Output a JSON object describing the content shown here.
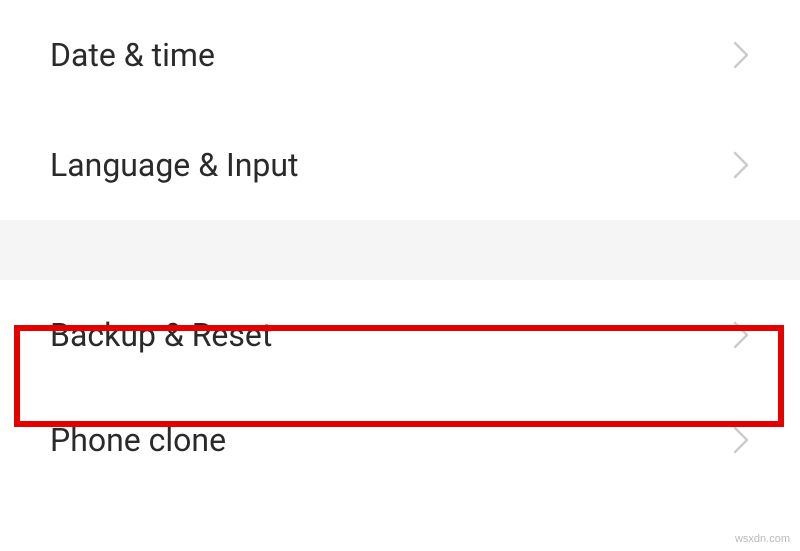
{
  "settings": {
    "items": [
      {
        "label": "Date & time"
      },
      {
        "label": "Language & Input"
      },
      {
        "label": "Backup & Reset"
      },
      {
        "label": "Phone clone"
      }
    ]
  },
  "colors": {
    "highlight": "#e60000",
    "chevron": "#cccccc",
    "gap_bg": "#f5f5f5"
  },
  "watermark": "wsxdn.com"
}
